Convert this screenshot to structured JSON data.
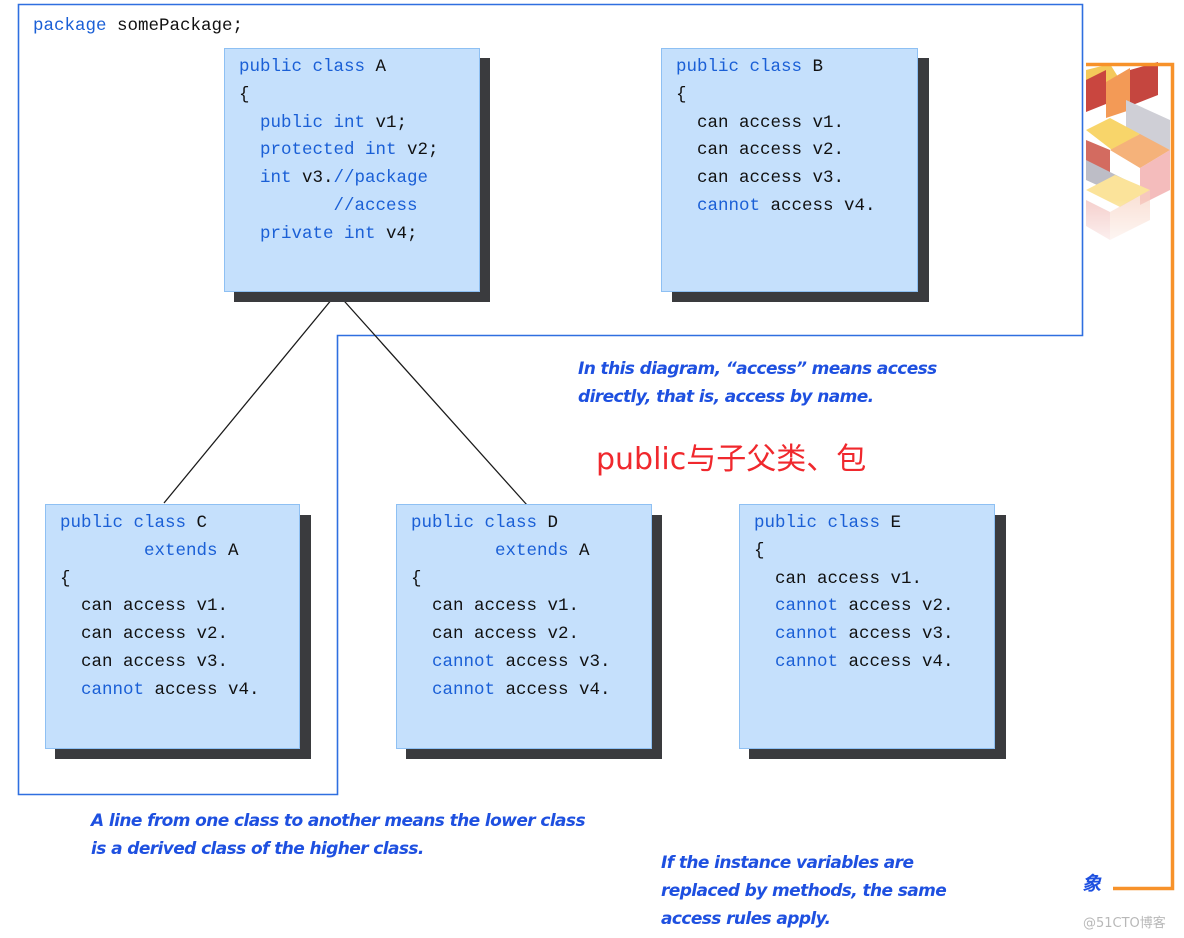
{
  "colors": {
    "keyword": "#1a5fd6",
    "plain_code": "#111111",
    "box_fill": "#c5e0fc",
    "box_border": "#8ec0f3",
    "box_shadow": "#3a3b3e",
    "package_outline": "#2f6fe0",
    "note_text": "#1e50e0",
    "title_red": "#f0282d",
    "bracket_orange": "#f7922a"
  },
  "package_label": {
    "keyword": "package",
    "name": "somePackage;"
  },
  "classes": {
    "A": {
      "lines": [
        [
          {
            "t": "public class",
            "kw": true
          },
          {
            "t": " A",
            "kw": false
          }
        ],
        [
          {
            "t": "{",
            "kw": false
          }
        ],
        [
          {
            "t": "  public int",
            "kw": true
          },
          {
            "t": " v1;",
            "kw": false
          }
        ],
        [
          {
            "t": "  protected int",
            "kw": true
          },
          {
            "t": " v2;",
            "kw": false
          }
        ],
        [
          {
            "t": "  int",
            "kw": true
          },
          {
            "t": " v3.",
            "kw": false
          },
          {
            "t": "//package",
            "kw": true
          }
        ],
        [
          {
            "t": "         //access",
            "kw": true
          }
        ],
        [
          {
            "t": "  private int",
            "kw": true
          },
          {
            "t": " v4;",
            "kw": false
          }
        ]
      ]
    },
    "B": {
      "lines": [
        [
          {
            "t": "public class",
            "kw": true
          },
          {
            "t": " B",
            "kw": false
          }
        ],
        [
          {
            "t": "{",
            "kw": false
          }
        ],
        [
          {
            "t": "  can access v1.",
            "kw": false
          }
        ],
        [
          {
            "t": "  can access v2.",
            "kw": false
          }
        ],
        [
          {
            "t": "  can access v3.",
            "kw": false
          }
        ],
        [
          {
            "t": "  cannot",
            "kw": true
          },
          {
            "t": " access v4.",
            "kw": false
          }
        ]
      ]
    },
    "C": {
      "lines": [
        [
          {
            "t": "public class",
            "kw": true
          },
          {
            "t": " C",
            "kw": false
          }
        ],
        [
          {
            "t": "        extends",
            "kw": true
          },
          {
            "t": " A",
            "kw": false
          }
        ],
        [
          {
            "t": "{",
            "kw": false
          }
        ],
        [
          {
            "t": "  can access v1.",
            "kw": false
          }
        ],
        [
          {
            "t": "  can access v2.",
            "kw": false
          }
        ],
        [
          {
            "t": "  can access v3.",
            "kw": false
          }
        ],
        [
          {
            "t": "  cannot",
            "kw": true
          },
          {
            "t": " access v4.",
            "kw": false
          }
        ]
      ]
    },
    "D": {
      "lines": [
        [
          {
            "t": "public class",
            "kw": true
          },
          {
            "t": " D",
            "kw": false
          }
        ],
        [
          {
            "t": "        extends",
            "kw": true
          },
          {
            "t": " A",
            "kw": false
          }
        ],
        [
          {
            "t": "{",
            "kw": false
          }
        ],
        [
          {
            "t": "  can access v1.",
            "kw": false
          }
        ],
        [
          {
            "t": "  can access v2.",
            "kw": false
          }
        ],
        [
          {
            "t": "  cannot",
            "kw": true
          },
          {
            "t": " access v3.",
            "kw": false
          }
        ],
        [
          {
            "t": "  cannot",
            "kw": true
          },
          {
            "t": " access v4.",
            "kw": false
          }
        ]
      ]
    },
    "E": {
      "lines": [
        [
          {
            "t": "public class",
            "kw": true
          },
          {
            "t": " E",
            "kw": false
          }
        ],
        [
          {
            "t": "{",
            "kw": false
          }
        ],
        [
          {
            "t": "  can access v1.",
            "kw": false
          }
        ],
        [
          {
            "t": "  cannot",
            "kw": true
          },
          {
            "t": " access v2.",
            "kw": false
          }
        ],
        [
          {
            "t": "  cannot",
            "kw": true
          },
          {
            "t": " access v3.",
            "kw": false
          }
        ],
        [
          {
            "t": "  cannot",
            "kw": true
          },
          {
            "t": " access v4.",
            "kw": false
          }
        ]
      ]
    }
  },
  "notes": {
    "access_meaning": [
      "In this diagram, “access” means access",
      "directly, that is, access by name."
    ],
    "line_meaning": [
      "A line from one class to another means the lower class",
      "is a derived class of the higher class."
    ],
    "methods_rule": [
      "If the instance variables are",
      "replaced by methods, the same",
      "access rules apply."
    ]
  },
  "title_cn": "public与子父类、包",
  "edge_glyph": "象",
  "watermark": "@51CTO博客",
  "relations": [
    {
      "from": "A",
      "to": "C",
      "type": "inheritance"
    },
    {
      "from": "A",
      "to": "D",
      "type": "inheritance"
    }
  ]
}
